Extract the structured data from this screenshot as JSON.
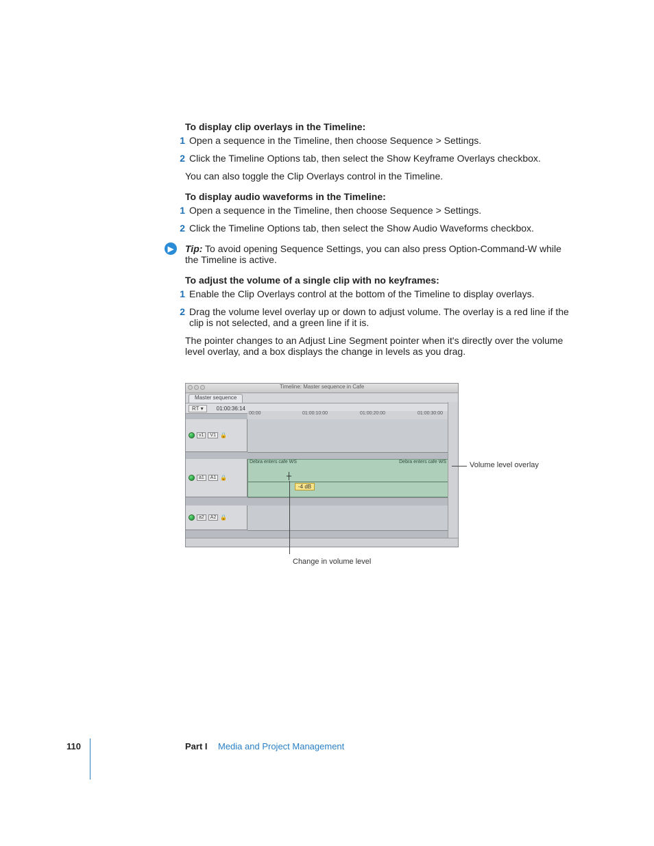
{
  "sections": {
    "h1": "To display clip overlays in the Timeline:",
    "s1_1": "Open a sequence in the Timeline, then choose Sequence > Settings.",
    "s1_2": "Click the Timeline Options tab, then select the Show Keyframe Overlays checkbox.",
    "s1_p": "You can also toggle the Clip Overlays control in the Timeline.",
    "h2": "To display audio waveforms in the Timeline:",
    "s2_1": "Open a sequence in the Timeline, then choose Sequence > Settings.",
    "s2_2": "Click the Timeline Options tab, then select the Show Audio Waveforms checkbox.",
    "tip_label": "Tip:",
    "tip_text": "To avoid opening Sequence Settings, you can also press Option-Command-W while the Timeline is active.",
    "h3": "To adjust the volume of a single clip with no keyframes:",
    "s3_1": "Enable the Clip Overlays control at the bottom of the Timeline to display overlays.",
    "s3_2": "Drag the volume level overlay up or down to adjust volume. The overlay is a red line if the clip is not selected, and a green line if it is.",
    "s3_p": "The pointer changes to an Adjust Line Segment pointer when it's directly over the volume level overlay, and a box displays the change in levels as you drag."
  },
  "screenshot": {
    "window_title": "Timeline: Master sequence in Cafe",
    "tab": "Master sequence",
    "rt": "RT ▾",
    "timecode": "01:00:36:14",
    "ruler": [
      "00:00",
      "01:00:10:00",
      "01:00:20:00",
      "01:00:30:00"
    ],
    "tracks": {
      "v1_a": "v1",
      "v1_b": "V1",
      "a1_a": "a1",
      "a1_b": "A1",
      "a2_a": "a2",
      "a2_b": "A2"
    },
    "clip1": "Debra enters cafe WS",
    "clip2": "Debra enters cafe WS",
    "db": "-4 dB"
  },
  "callouts": {
    "right": "Volume level overlay",
    "bottom": "Change in volume level"
  },
  "footer": {
    "page": "110",
    "part": "Part I",
    "title": "Media and Project Management"
  }
}
